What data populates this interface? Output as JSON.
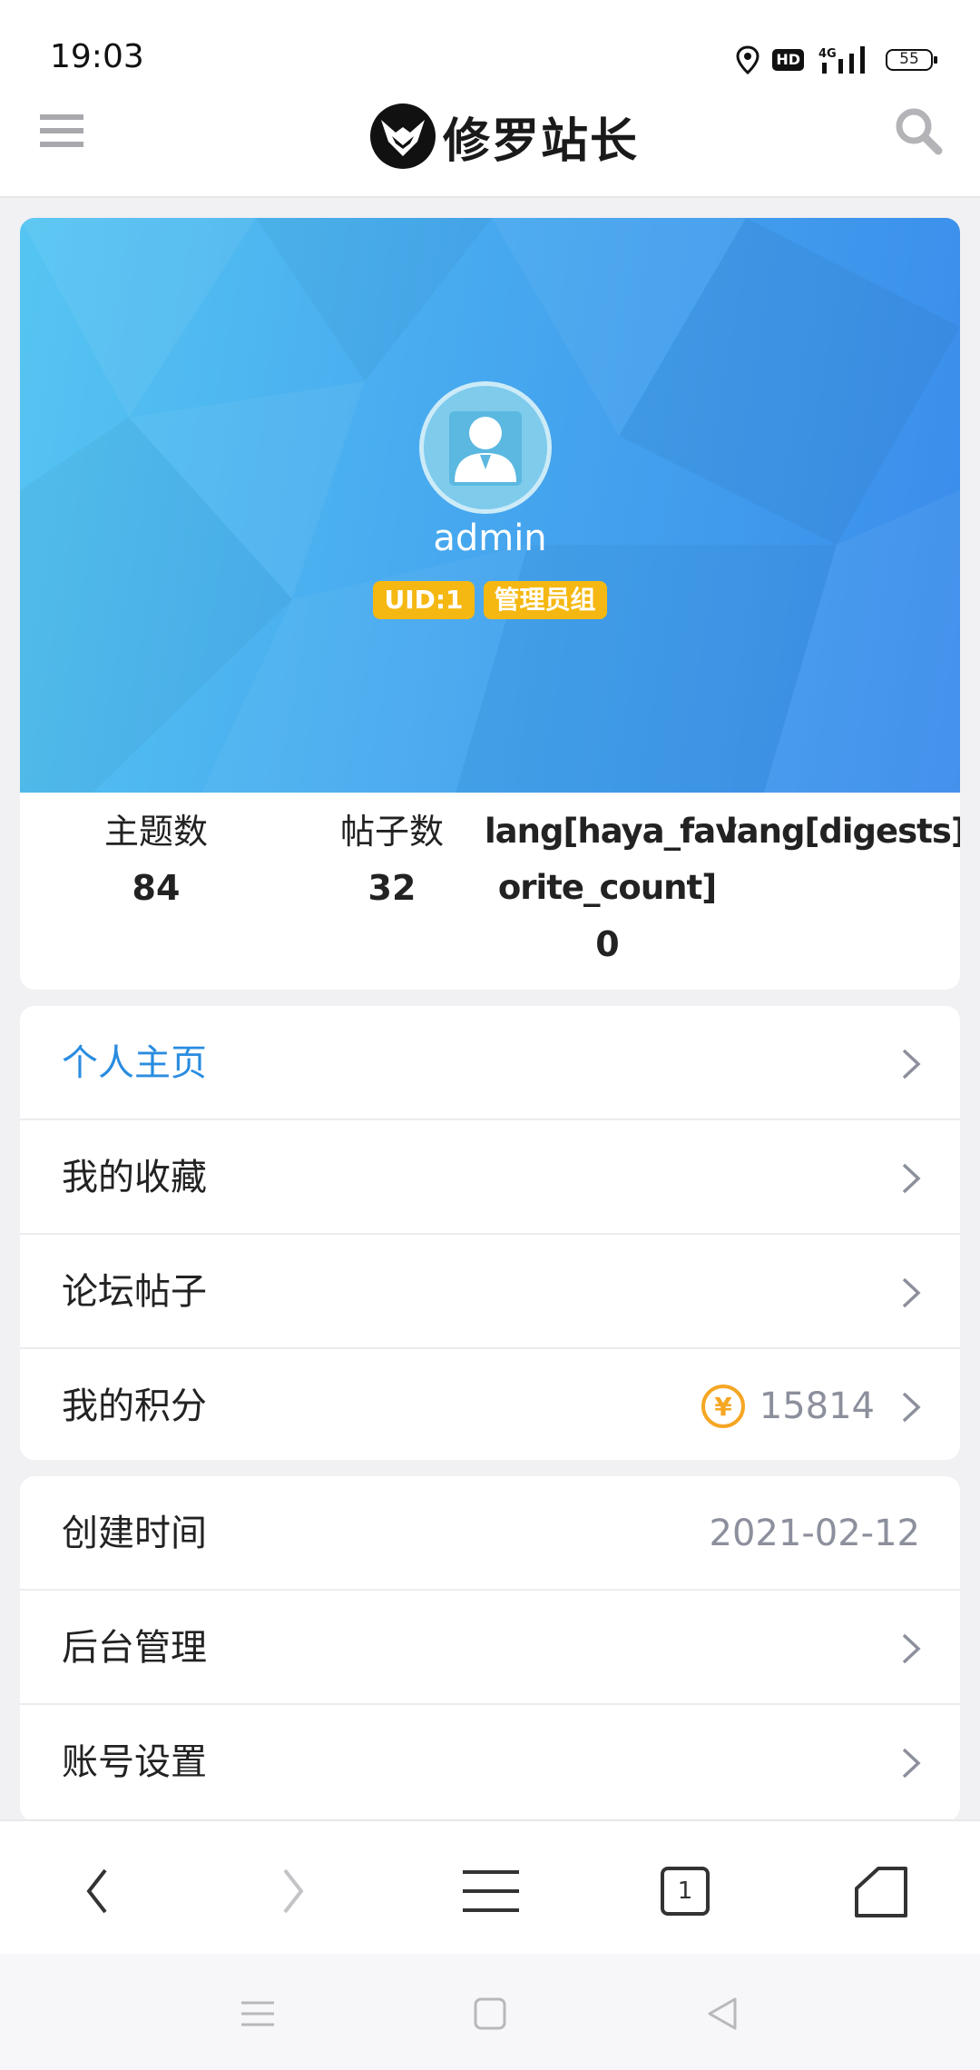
{
  "status_bar": {
    "time": "19:03",
    "hd": "HD",
    "network": "4G",
    "battery": "55"
  },
  "header": {
    "logo_text": "修罗站长",
    "menu_icon": "hamburger-icon",
    "search_icon": "search-icon"
  },
  "profile": {
    "username": "admin",
    "uid_badge": "UID:1",
    "group_badge": "管理员组",
    "banner_colors": [
      "#55c5f2",
      "#3a8ceb"
    ],
    "badge_color": "#f5b812"
  },
  "stats": [
    {
      "label": "主题数",
      "value": "84"
    },
    {
      "label": "帖子数",
      "value": "32"
    },
    {
      "label_line1": "lang[haya_fav",
      "label_line2": "orite_count]",
      "value": "0"
    },
    {
      "label": "lang[digests]"
    }
  ],
  "menu_primary": [
    {
      "label": "个人主页",
      "active": true
    },
    {
      "label": "我的收藏"
    },
    {
      "label": "论坛帖子"
    },
    {
      "label": "我的积分",
      "value": "15814",
      "icon": "yuan-coin-icon"
    }
  ],
  "menu_secondary": [
    {
      "label": "创建时间",
      "value": "2021-02-12"
    },
    {
      "label": "后台管理"
    },
    {
      "label": "账号设置"
    }
  ],
  "browser_bar": {
    "tabs_count": "1"
  },
  "colors": {
    "accent": "#2a8ce0",
    "muted_text": "#8c8f9c",
    "coin": "#f5a623"
  }
}
